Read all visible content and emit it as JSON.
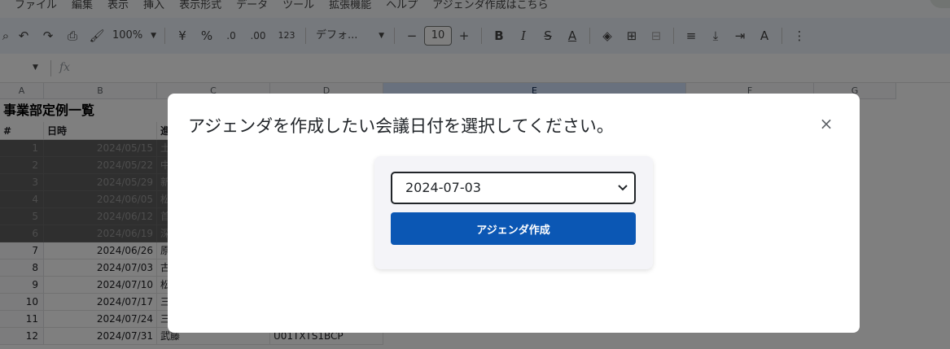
{
  "menu": [
    "ファイル",
    "編集",
    "表示",
    "挿入",
    "表示形式",
    "データ",
    "ツール",
    "拡張機能",
    "ヘルプ",
    "アジェンダ作成はこちら"
  ],
  "toolbar": {
    "zoom": "100%",
    "currency": "¥",
    "percent": "%",
    "decrease_decimal": ".0",
    "increase_decimal": ".00",
    "number_format": "123",
    "font": "デフォ...",
    "font_size": "10",
    "minus": "−",
    "plus": "+",
    "bold": "B",
    "italic": "I",
    "strike": "S",
    "text_color": "A"
  },
  "formula": {
    "fx": "fx"
  },
  "columns": [
    "A",
    "B",
    "C",
    "D",
    "E",
    "F",
    "G"
  ],
  "sheet": {
    "title": "事業部定例一覧",
    "header_num": "#",
    "header_date": "日時",
    "header_c": "進",
    "rows": [
      {
        "num": "1",
        "date": "2024/05/15",
        "c": "土",
        "d": "",
        "hidden": true
      },
      {
        "num": "2",
        "date": "2024/05/22",
        "c": "中",
        "d": "",
        "hidden": true
      },
      {
        "num": "3",
        "date": "2024/05/29",
        "c": "新",
        "d": "",
        "hidden": true
      },
      {
        "num": "4",
        "date": "2024/06/05",
        "c": "松",
        "d": "",
        "hidden": true
      },
      {
        "num": "5",
        "date": "2024/06/12",
        "c": "首",
        "d": "",
        "hidden": true
      },
      {
        "num": "6",
        "date": "2024/06/19",
        "c": "深",
        "d": "",
        "hidden": true
      },
      {
        "num": "7",
        "date": "2024/06/26",
        "c": "原",
        "d": "",
        "hidden": false
      },
      {
        "num": "8",
        "date": "2024/07/03",
        "c": "古",
        "d": "",
        "hidden": false
      },
      {
        "num": "9",
        "date": "2024/07/10",
        "c": "松",
        "d": "",
        "hidden": false
      },
      {
        "num": "10",
        "date": "2024/07/17",
        "c": "三",
        "d": "",
        "hidden": false
      },
      {
        "num": "11",
        "date": "2024/07/24",
        "c": "三",
        "d": "",
        "hidden": false
      },
      {
        "num": "12",
        "date": "2024/07/31",
        "c": "武藤",
        "d": "U01TXTS1BCP",
        "hidden": false
      }
    ]
  },
  "modal": {
    "title": "アジェンダを作成したい会議日付を選択してください。",
    "close": "×",
    "selected_date": "2024-07-03",
    "button_label": "アジェンダ作成"
  },
  "colors": {
    "primary_button": "#0b57b4",
    "selected_column": "#d3e3fd",
    "hidden_rows": "#5f5f5f"
  }
}
